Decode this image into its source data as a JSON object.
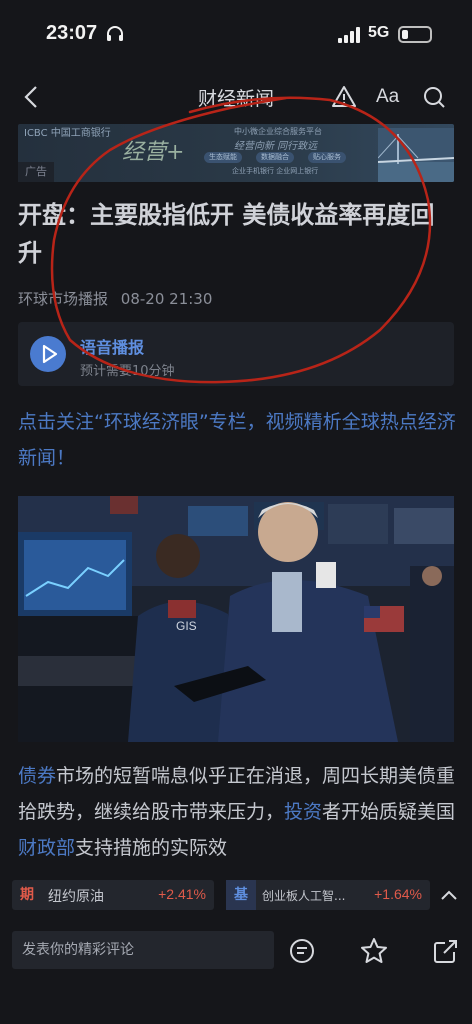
{
  "status_bar": {
    "time": "23:07",
    "network": "5G"
  },
  "nav": {
    "title": "财经新闻",
    "font_size_label": "Aa"
  },
  "ad": {
    "bank_name": "ICBC 中国工商银行",
    "slogan": "经营+",
    "subtitle_1": "中小微企业综合服务平台",
    "subtitle_2": "经营向新 同行致远",
    "pills": [
      "生态赋能",
      "数据融合",
      "贴心服务"
    ],
    "footer": "企业手机银行    企业网上银行",
    "tag": "广告"
  },
  "article": {
    "title": "开盘：主要股指低开 美债收益率再度回升",
    "source": "环球市场播报",
    "datetime": "08-20 21:30"
  },
  "audio": {
    "label": "语音播报",
    "estimate": "预计需要10分钟"
  },
  "promo_text": "点击关注“环球经济眼”专栏，视频精析全球热点经济新闻！",
  "photo": {
    "sign_text": "GIS"
  },
  "body": {
    "link_1": "债券",
    "text_1": "市场的短暂喘息似乎正在消退，周四长期美债重拾跌势，继续给股市带来压力，",
    "link_2": "投资",
    "text_2": "者开始质疑美国",
    "link_3": "财政部",
    "text_3": "支持措施的实际效"
  },
  "tickers": [
    {
      "badge": "期",
      "name": "纽约原油",
      "change": "+2.41%"
    },
    {
      "badge": "基",
      "name": "创业板人工智...",
      "change": "+1.64%"
    }
  ],
  "comment": {
    "placeholder": "发表你的精彩评论"
  },
  "colors": {
    "accent_blue": "#4c79c4",
    "up_red": "#e05a4a",
    "annotation_red": "#b82418"
  }
}
